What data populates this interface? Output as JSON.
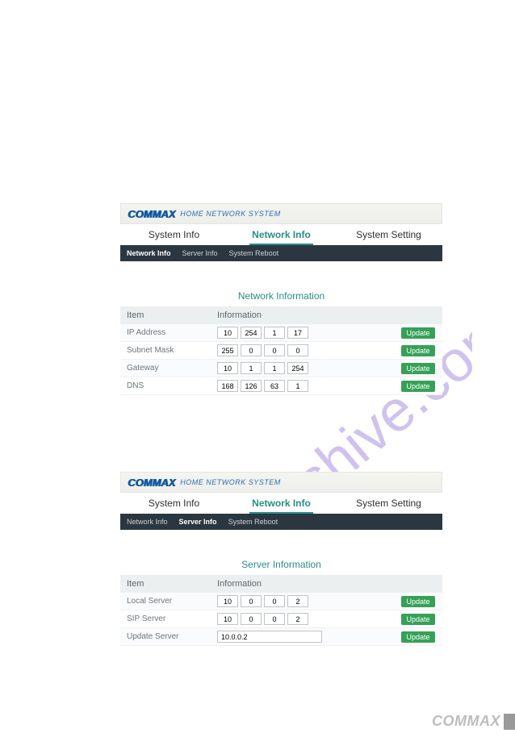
{
  "watermark_text": "manualshive.com",
  "brand": "COMMAX",
  "brand_sub": "HOME NETWORK SYSTEM",
  "tabs": {
    "system_info": "System Info",
    "network_info": "Network Info",
    "system_setting": "System Setting"
  },
  "subnav": {
    "network_info": "Network Info",
    "server_info": "Server Info",
    "system_reboot": "System Reboot"
  },
  "panel1": {
    "title": "Network Information",
    "th_item": "Item",
    "th_info": "Information",
    "rows": {
      "ip_address": {
        "label": "IP Address",
        "v": [
          "10",
          "254",
          "1",
          "17"
        ],
        "btn": "Update"
      },
      "subnet_mask": {
        "label": "Subnet Mask",
        "v": [
          "255",
          "0",
          "0",
          "0"
        ],
        "btn": "Update"
      },
      "gateway": {
        "label": "Gateway",
        "v": [
          "10",
          "1",
          "1",
          "254"
        ],
        "btn": "Update"
      },
      "dns": {
        "label": "DNS",
        "v": [
          "168",
          "126",
          "63",
          "1"
        ],
        "btn": "Update"
      }
    }
  },
  "panel2": {
    "title": "Server Information",
    "th_item": "Item",
    "th_info": "Information",
    "rows": {
      "local_server": {
        "label": "Local Server",
        "v": [
          "10",
          "0",
          "0",
          "2"
        ],
        "btn": "Update"
      },
      "sip_server": {
        "label": "SIP Server",
        "v": [
          "10",
          "0",
          "0",
          "2"
        ],
        "btn": "Update"
      },
      "update_server": {
        "label": "Update Server",
        "value": "10.0.0.2",
        "btn": "Update"
      }
    }
  },
  "footer_brand": "COMMAX"
}
